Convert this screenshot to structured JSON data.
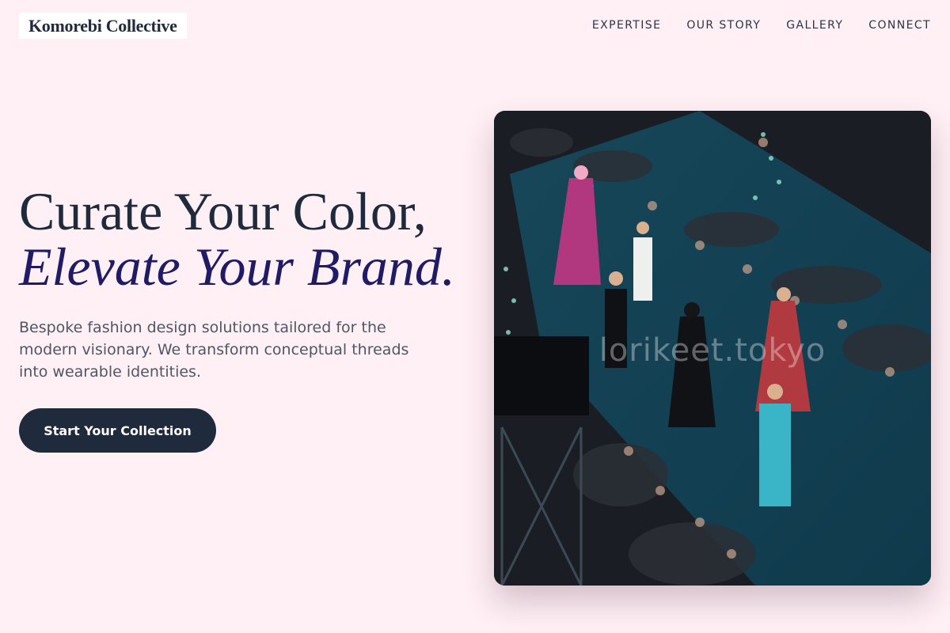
{
  "brand": {
    "name": "Komorebi Collective"
  },
  "nav": {
    "items": [
      {
        "label": "EXPERTISE"
      },
      {
        "label": "OUR STORY"
      },
      {
        "label": "GALLERY"
      },
      {
        "label": "CONNECT"
      }
    ]
  },
  "hero": {
    "headline_line1": "Curate Your Color,",
    "headline_line2": "Elevate Your Brand.",
    "subtitle": "Bespoke fashion design solutions tailored for the modern visionary. We transform conceptual threads into wearable identities.",
    "cta_label": "Start Your Collection"
  },
  "image": {
    "watermark": "lorikeet.tokyo"
  },
  "colors": {
    "background": "#fff0f5",
    "primary": "#1f2a3c",
    "accent": "#1f1b66"
  }
}
